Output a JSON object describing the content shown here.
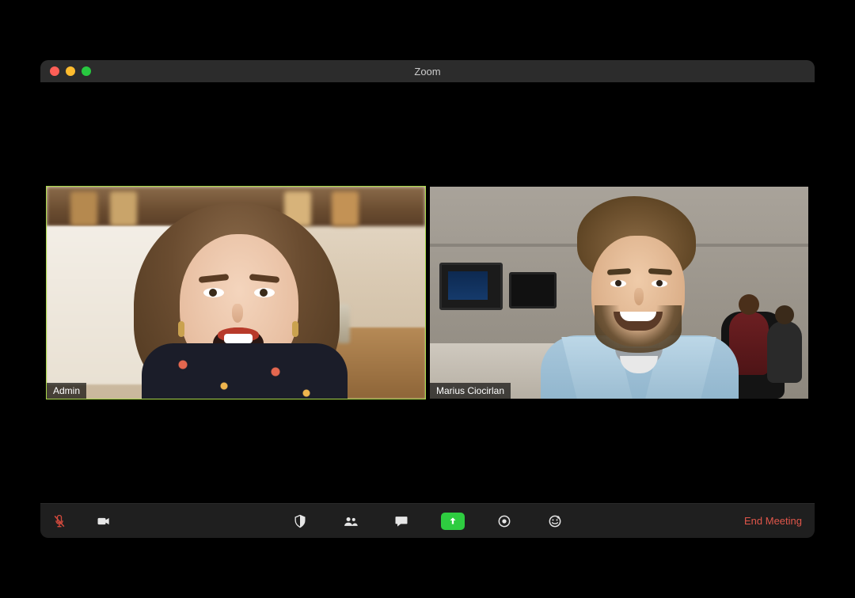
{
  "window": {
    "title": "Zoom"
  },
  "participants": [
    {
      "name": "Admin",
      "active": true
    },
    {
      "name": "Marius Ciocirlan",
      "active": false
    }
  ],
  "toolbar": {
    "end_label": "End Meeting"
  },
  "colors": {
    "active_border": "#a8d948",
    "share_green": "#2ecc40",
    "end_red": "#e0564a",
    "mic_muted": "#d34a3d"
  }
}
